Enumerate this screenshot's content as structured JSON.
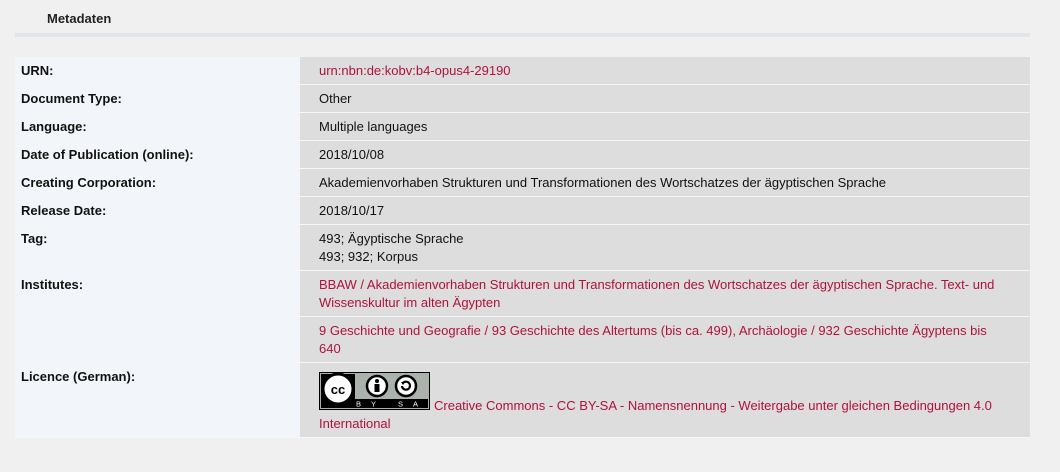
{
  "header": {
    "title": "Metadaten"
  },
  "rows": {
    "urn": {
      "label": "URN:",
      "value": "urn:nbn:de:kobv:b4-opus4-29190"
    },
    "doctype": {
      "label": "Document Type:",
      "value": "Other"
    },
    "language": {
      "label": "Language:",
      "value": "Multiple languages"
    },
    "pubdate": {
      "label": "Date of Publication (online):",
      "value": "2018/10/08"
    },
    "corporation": {
      "label": "Creating Corporation:",
      "value": "Akademienvorhaben Strukturen und Transformationen des Wortschatzes der ägyptischen Sprache"
    },
    "release": {
      "label": "Release Date:",
      "value": "2018/10/17"
    },
    "tag": {
      "label": "Tag:",
      "values": [
        "493; Ägyptische Sprache",
        "493; 932; Korpus"
      ]
    },
    "institutes": {
      "label": "Institutes:",
      "values": [
        "BBAW / Akademienvorhaben Strukturen und Transformationen des Wortschatzes der ägyptischen Sprache. Text- und Wissenskultur im alten Ägypten",
        "9 Geschichte und Geografie / 93 Geschichte des Altertums (bis ca. 499), Archäologie / 932 Geschichte Ägyptens bis 640"
      ]
    },
    "licence": {
      "label": "Licence (German):",
      "badge_text": "BY SA",
      "value": "Creative Commons - CC BY-SA - Namensnennung - Weitergabe unter gleichen Bedingungen 4.0 International"
    }
  },
  "colors": {
    "link": "#b0123b",
    "label_bg": "#f2f6fa",
    "value_bg": "#dddddd",
    "page_bg": "#f0f0f0"
  }
}
